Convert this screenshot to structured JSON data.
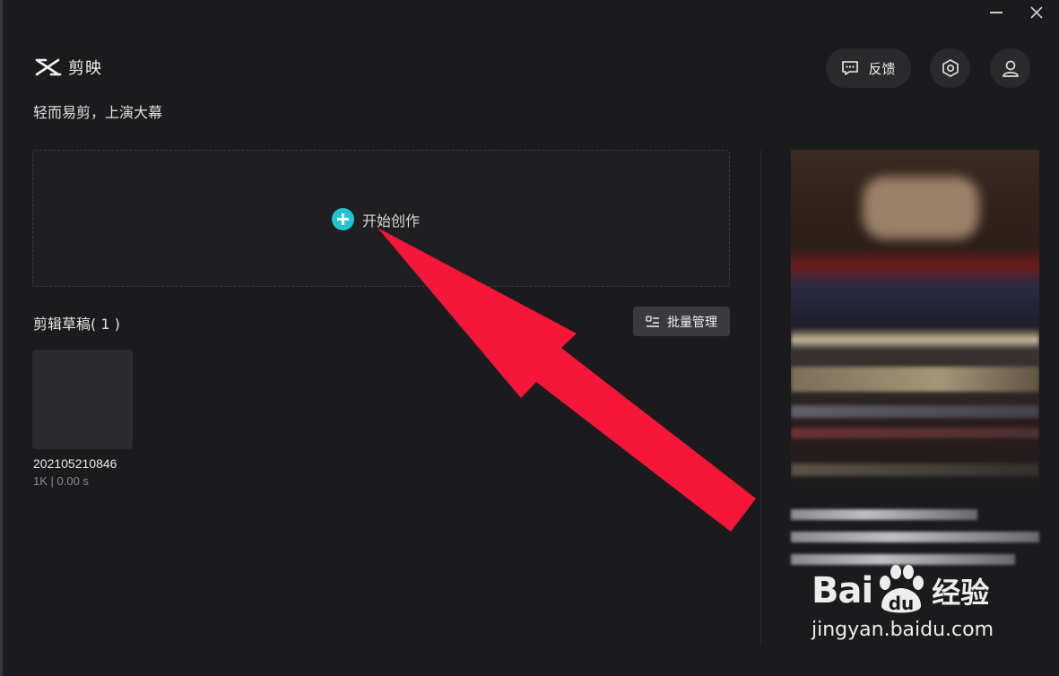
{
  "window": {
    "minimize_icon": "minimize-icon",
    "close_icon": "close-icon"
  },
  "header": {
    "app_name": "剪映",
    "slogan": "轻而易剪，上演大幕",
    "feedback_label": "反馈",
    "settings_icon": "hexagon-settings-icon",
    "account_icon": "user-icon"
  },
  "create": {
    "label": "开始创作",
    "icon": "plus-circle-icon",
    "accent": "#21c4cf"
  },
  "drafts": {
    "title": "剪辑草稿( 1 )",
    "batch_label": "批量管理",
    "items": [
      {
        "name": "202105210846",
        "meta": "1K | 0.00 s"
      }
    ]
  },
  "annotation": {
    "arrow_color": "#f5163a"
  },
  "watermark": {
    "brand_left": "Bai",
    "brand_right": "du",
    "brand_suffix": "经验",
    "url": "jingyan.baidu.com"
  }
}
